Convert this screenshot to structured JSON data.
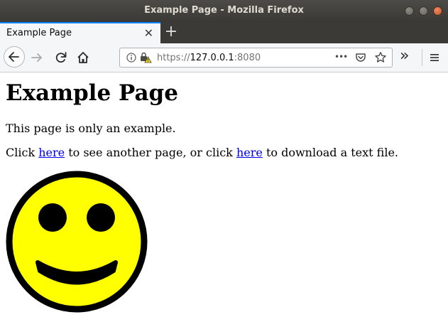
{
  "window": {
    "title": "Example Page - Mozilla Firefox"
  },
  "tabs": [
    {
      "label": "Example Page",
      "close_glyph": "✕"
    }
  ],
  "new_tab_glyph": "+",
  "navbar": {
    "url_scheme": "https://",
    "url_host": "127.0.0.1",
    "url_port": ":8080",
    "page_actions_glyph": "•••",
    "overflow_glyph": "»"
  },
  "page": {
    "heading": "Example Page",
    "paragraph1": "This page is only an example.",
    "p2_before": "Click ",
    "link1": "here",
    "p2_middle": " to see another page, or click ",
    "link2": "here",
    "p2_after": " to download a text file.",
    "image_icon": "smiley-face",
    "image_colors": {
      "face": "#ffff00",
      "outline": "#000000"
    }
  },
  "colors": {
    "tab_accent": "#0a84ff",
    "link": "#0000ee"
  }
}
